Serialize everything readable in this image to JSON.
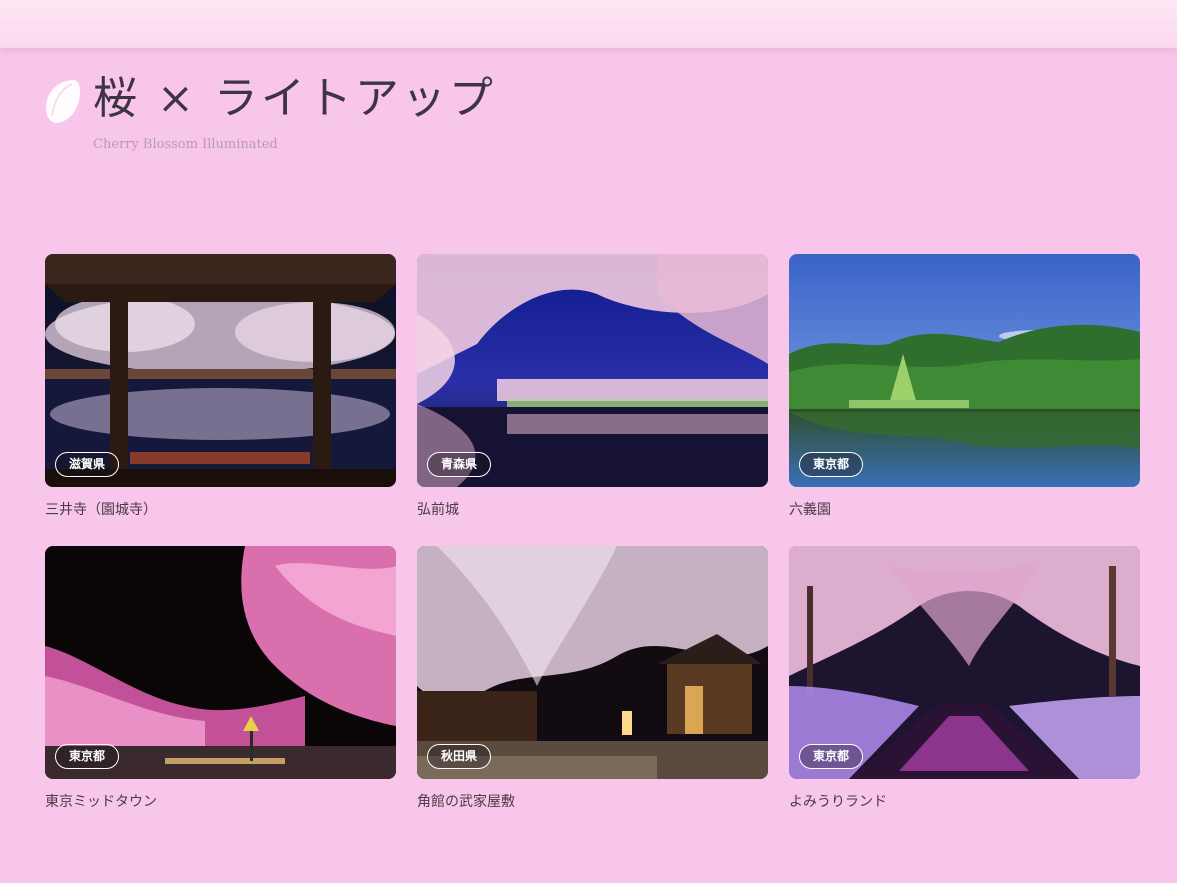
{
  "header": {
    "title": "桜 × ライトアップ",
    "subtitle": "Cherry Blossom Illuminated",
    "logo_icon": "sakura-petal-icon"
  },
  "spots": [
    {
      "prefecture": "滋賀県",
      "name": "三井寺（園城寺）"
    },
    {
      "prefecture": "青森県",
      "name": "弘前城"
    },
    {
      "prefecture": "東京都",
      "name": "六義園"
    },
    {
      "prefecture": "東京都",
      "name": "東京ミッドタウン"
    },
    {
      "prefecture": "秋田県",
      "name": "角館の武家屋敷"
    },
    {
      "prefecture": "東京都",
      "name": "よみうりランド"
    }
  ],
  "colors": {
    "background": "#f8c6ea",
    "topbar": "#fde6f3",
    "title_text": "#3e3443",
    "subtitle_text": "#b69bb0"
  }
}
